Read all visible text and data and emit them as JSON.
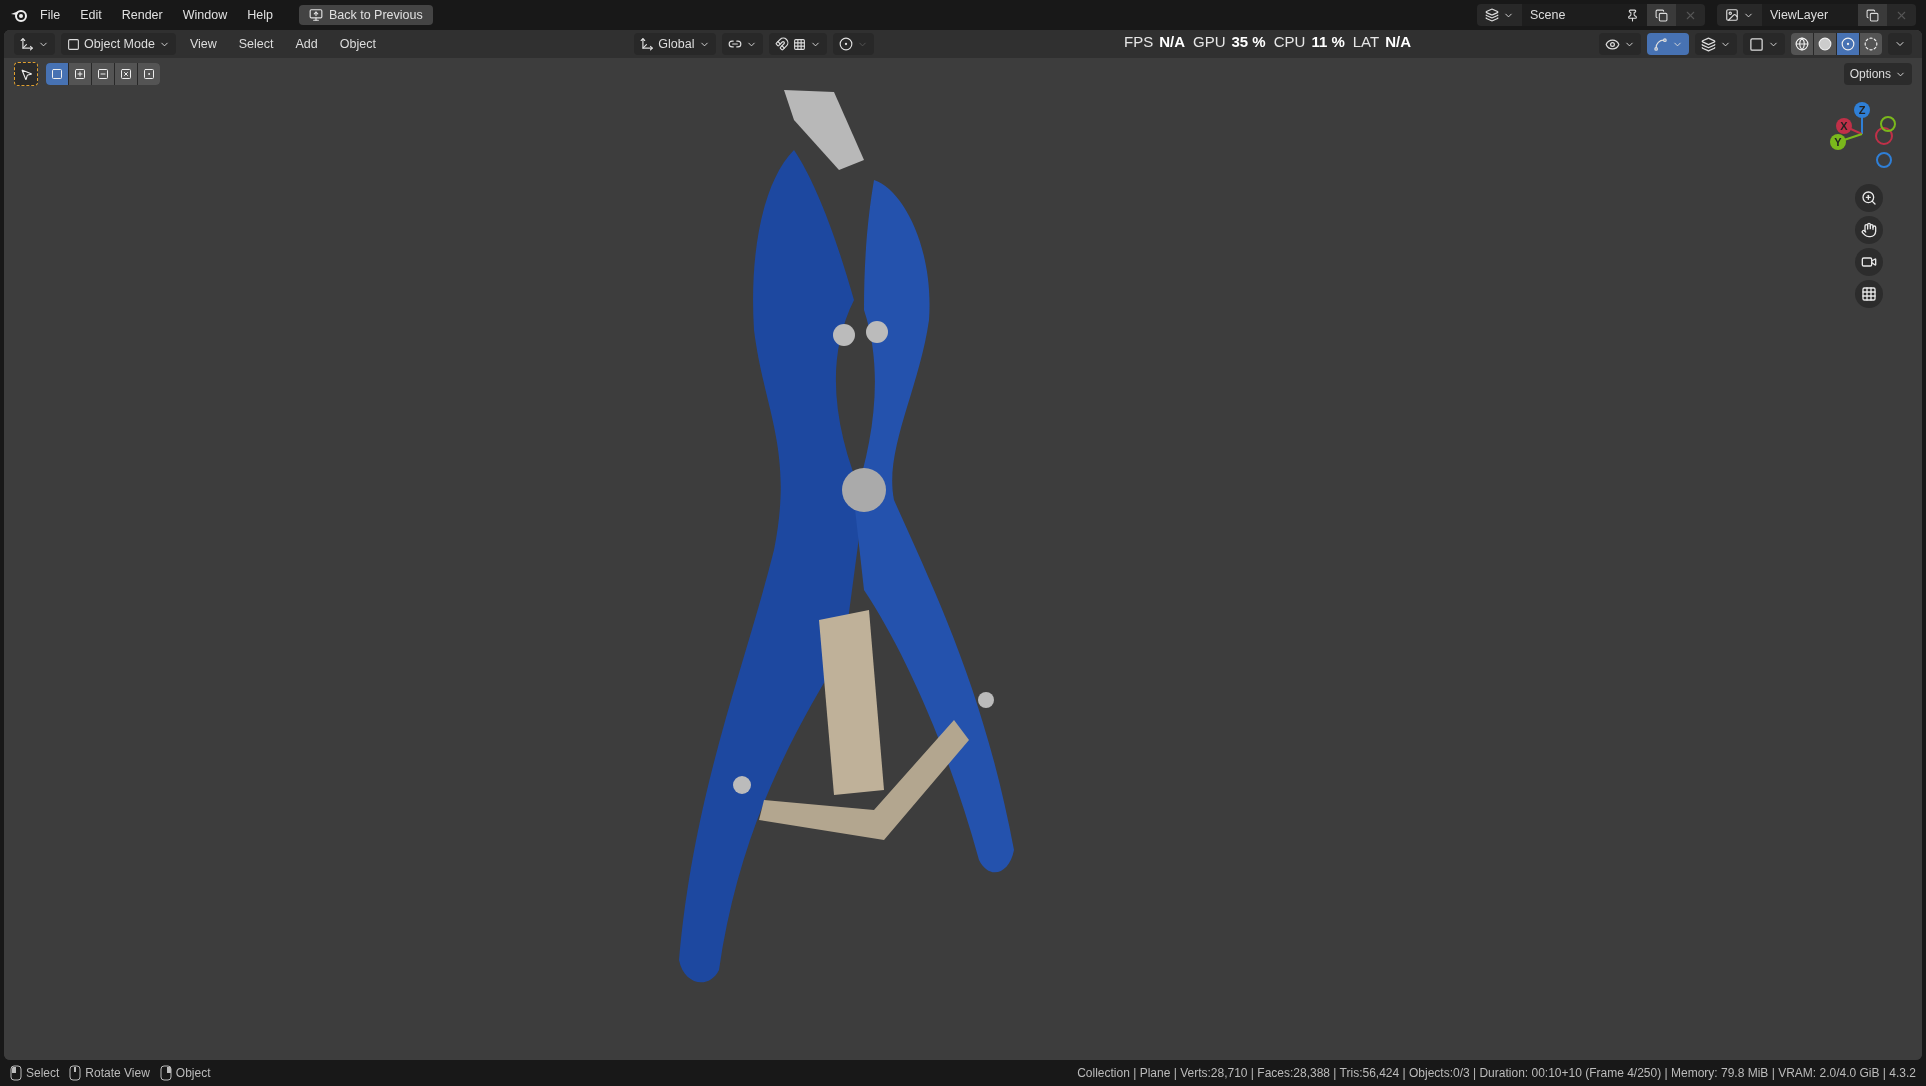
{
  "menu_bar": {
    "menus": [
      "File",
      "Edit",
      "Render",
      "Window",
      "Help"
    ],
    "back_button": "Back to Previous",
    "scene": "Scene",
    "view_layer": "ViewLayer"
  },
  "header": {
    "mode": "Object Mode",
    "menus": [
      "View",
      "Select",
      "Add",
      "Object"
    ],
    "orientation": "Global",
    "stats": [
      {
        "label": "FPS",
        "value": "N/A"
      },
      {
        "label": "GPU",
        "value": "35 %"
      },
      {
        "label": "CPU",
        "value": "11 %"
      },
      {
        "label": "LAT",
        "value": "N/A"
      }
    ],
    "toggles": [
      {
        "kind": "visibility",
        "selected": false
      },
      {
        "kind": "gizmo",
        "selected": true
      },
      {
        "kind": "overlay",
        "selected": false
      },
      {
        "kind": "xray",
        "selected": false
      }
    ],
    "shading": [
      {
        "kind": "wireframe",
        "selected": false
      },
      {
        "kind": "solid",
        "selected": false
      },
      {
        "kind": "material",
        "selected": true
      },
      {
        "kind": "rendered",
        "selected": false
      }
    ]
  },
  "toolbar": {
    "select_modes": [
      {
        "kind": "new",
        "selected": true
      },
      {
        "kind": "extend",
        "selected": false
      },
      {
        "kind": "subtract",
        "selected": false
      },
      {
        "kind": "invert",
        "selected": false
      },
      {
        "kind": "intersect",
        "selected": false
      }
    ],
    "options": "Options"
  },
  "viewport": {
    "gizmo": {
      "axes": [
        {
          "label": "Z",
          "color": "#2f7fd6"
        },
        {
          "label": "X",
          "color": "#c03048"
        },
        {
          "label": "Y",
          "color": "#7ab81c"
        }
      ]
    }
  },
  "status_bar": {
    "hints": [
      {
        "kind": "left",
        "label": "Select"
      },
      {
        "kind": "middle",
        "label": "Rotate View"
      },
      {
        "kind": "right",
        "label": "Object"
      }
    ],
    "info": "Collection | Plane | Verts:28,710 | Faces:28,388 | Tris:56,424 | Objects:0/3 | Duration: 00:10+10 (Frame 4/250) | Memory: 79.8 MiB | VRAM: 2.0/4.0 GiB | 4.3.2"
  }
}
